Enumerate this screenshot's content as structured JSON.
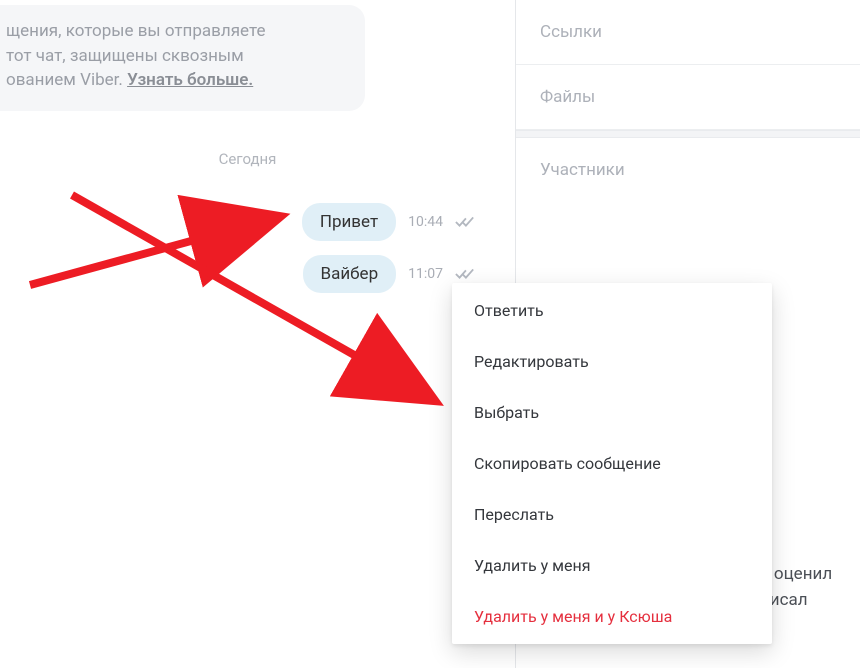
{
  "info_bubble": {
    "line1": "щения, которые вы отправляете",
    "line2": "тот чат, защищены сквозным",
    "line3_pre": "ованием Viber. ",
    "learn_more": "Узнать больше."
  },
  "date_divider": "Сегодня",
  "messages": [
    {
      "text": "Привет",
      "time": "10:44"
    },
    {
      "text": "Вайбер",
      "time": "11:07"
    }
  ],
  "side_panel": {
    "links": "Ссылки",
    "files": "Файлы",
    "participants": "Участники",
    "truncated_line1": "о оценил",
    "truncated_line2": "писал"
  },
  "context_menu": {
    "reply": "Ответить",
    "edit": "Редактировать",
    "select": "Выбрать",
    "copy": "Скопировать сообщение",
    "forward": "Переслать",
    "delete_me": "Удалить у меня",
    "delete_both": "Удалить у меня и у Ксюша"
  }
}
